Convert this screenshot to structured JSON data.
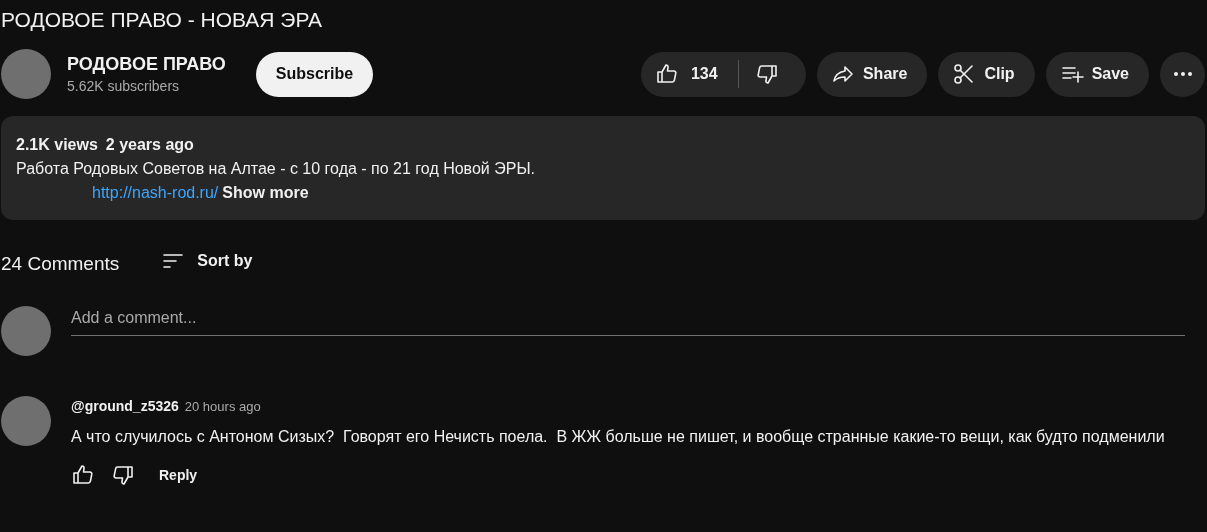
{
  "video_title": "РОДОВОЕ ПРАВО - НОВАЯ ЭРА",
  "channel": {
    "name": "РОДОВОЕ ПРАВО",
    "subscribers": "5.62K subscribers",
    "subscribe_label": "Subscribe"
  },
  "actions": {
    "likes": "134",
    "share": "Share",
    "clip": "Clip",
    "save": "Save"
  },
  "description": {
    "views": "2.1K views",
    "age": "2 years ago",
    "text": "Работа Родовых Советов на Алтае - с 10 года - по 21 год Новой ЭРЫ.",
    "link": "http://nash-rod.ru/",
    "show_more": "Show more"
  },
  "comments_header": {
    "count": "24 Comments",
    "sort": "Sort by"
  },
  "add_comment": {
    "placeholder": "Add a comment..."
  },
  "comments": [
    {
      "author": "@ground_z5326",
      "time": "20 hours ago",
      "text": "А что случилось с Антоном Сизых?  Говорят его Нечисть поела.  В ЖЖ больше не пишет, и вообще странные какие-то вещи, как будто подменили",
      "reply": "Reply"
    }
  ]
}
